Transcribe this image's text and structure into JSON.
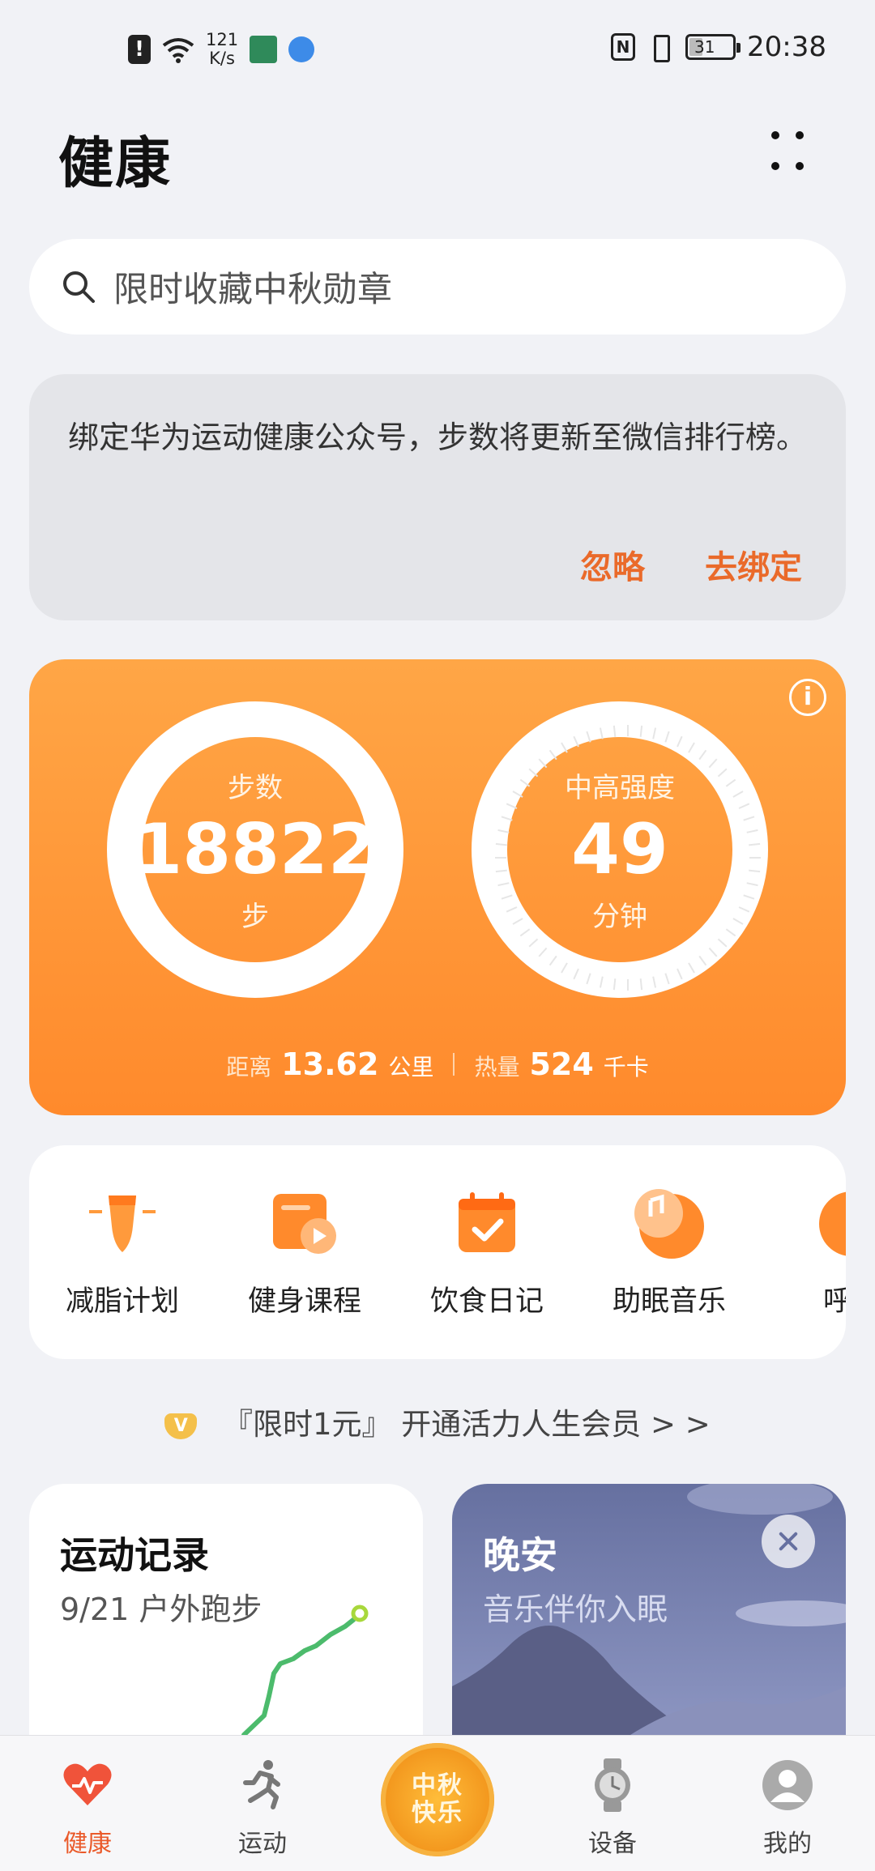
{
  "status_bar": {
    "net_speed_value": "121",
    "net_speed_unit": "K/s",
    "battery": "31",
    "time": "20:38"
  },
  "header": {
    "title": "健康"
  },
  "search": {
    "placeholder": "限时收藏中秋勋章"
  },
  "notice": {
    "text": "绑定华为运动健康公众号，步数将更新至微信排行榜。",
    "ignore": "忽略",
    "bind": "去绑定"
  },
  "activity": {
    "steps_label": "步数",
    "steps_value": "18822",
    "steps_unit": "步",
    "intensity_label": "中高强度",
    "intensity_value": "49",
    "intensity_unit": "分钟",
    "distance_label": "距离",
    "distance_value": "13.62",
    "distance_unit": "公里",
    "calories_label": "热量",
    "calories_value": "524",
    "calories_unit": "千卡"
  },
  "services": [
    {
      "label": "减脂计划",
      "icon": "fat-loss-icon"
    },
    {
      "label": "健身课程",
      "icon": "fitness-course-icon"
    },
    {
      "label": "饮食日记",
      "icon": "diet-diary-icon"
    },
    {
      "label": "助眠音乐",
      "icon": "sleep-music-icon"
    },
    {
      "label": "呼吸",
      "icon": "breathing-icon"
    }
  ],
  "vip": {
    "badge": "V",
    "text": "『限时1元』 开通活力人生会员 > >"
  },
  "cards": {
    "record_title": "运动记录",
    "record_subtitle": "9/21 户外跑步",
    "night_title": "晚安",
    "night_subtitle": "音乐伴你入眠"
  },
  "tabs": [
    {
      "label": "健康",
      "icon": "heart-icon",
      "active": true
    },
    {
      "label": "运动",
      "icon": "running-icon"
    },
    {
      "label": "设备",
      "icon": "watch-icon"
    },
    {
      "label": "我的",
      "icon": "profile-icon"
    }
  ],
  "mooncake": {
    "line1": "中秋",
    "line2": "快乐"
  },
  "colors": {
    "accent": "#ea6a2a",
    "activity_top": "#ffa646",
    "activity_bottom": "#ff8a2c",
    "chart_green": "#4cbb6c"
  }
}
